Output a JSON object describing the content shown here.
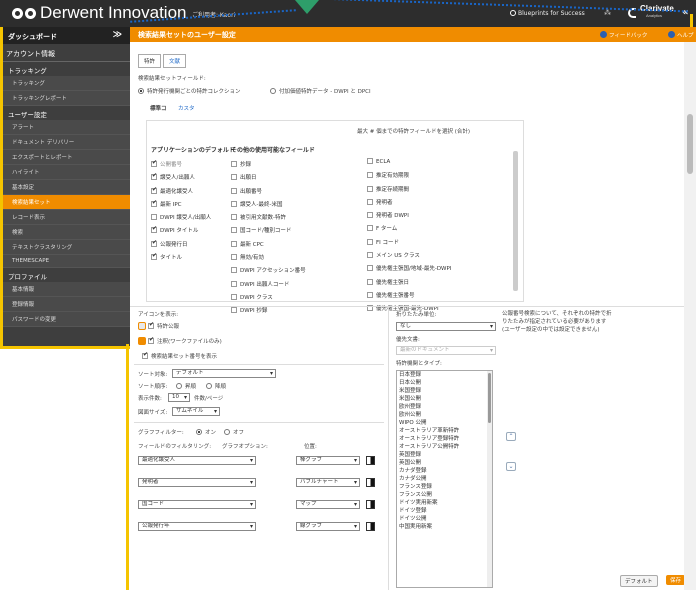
{
  "header": {
    "brand": "Derwent Innovation",
    "user": "ご利用者: Kaori",
    "blueprints": "Blueprints for Success",
    "lang_icon": "globe-language-icon",
    "clarivate": "Clarivate",
    "clarivate_sub": "Analytics",
    "collapse": "«"
  },
  "sidebar": {
    "head": "ダッシュボード",
    "account": "アカウント情報",
    "groups": [
      {
        "label": "トラッキング",
        "items": [
          "トラッキング",
          "トラッキングレポート"
        ]
      },
      {
        "label": "ユーザー設定",
        "items": [
          "アラート",
          "ドキュメント デリバリー",
          "エクスポートとレポート",
          "ハイライト",
          "基本設定",
          "検索結果セット",
          "レコード表示",
          "検索",
          "テキストクラスタリング",
          "THEMESCAPE"
        ]
      },
      {
        "label": "プロファイル",
        "items": [
          "基本情報",
          "登録情報",
          "パスワードの変更"
        ]
      }
    ],
    "active": "検索結果セット"
  },
  "titlebar": {
    "title": "検索結果セットのユーザー設定",
    "feedback": "フィードバック",
    "help": "ヘルプ"
  },
  "tabs": [
    "特許",
    "文献"
  ],
  "fields_section": {
    "label": "検索結果セットフィールド:",
    "radio1": "特許発行機関ごとの特許コレクション",
    "radio2": "付加価値特許データ - DWPI と DPCI",
    "sub_tab1": "標準コ",
    "sub_tab2": "カスタ",
    "max_note": "最大 # 個までの特許フィールドを選択 (合計)",
    "default_header": "アプリケーションのデフォルト",
    "other_header": "その他の使用可能なフィールド",
    "defaults": [
      {
        "label": "公開番号",
        "checked": true,
        "grey": true
      },
      {
        "label": "譲受人/出願人",
        "checked": true,
        "grey": false
      },
      {
        "label": "最適化譲受人",
        "checked": true,
        "grey": false
      },
      {
        "label": "最新 IPC",
        "checked": true,
        "grey": false
      },
      {
        "label": "DWPI 譲受人/出願人",
        "checked": false,
        "grey": false
      },
      {
        "label": "DWPI タイトル",
        "checked": true,
        "grey": false
      },
      {
        "label": "公報発行日",
        "checked": true,
        "grey": false
      },
      {
        "label": "タイトル",
        "checked": true,
        "grey": false
      }
    ],
    "others_a": [
      "抄録",
      "出願日",
      "出願番号",
      "譲受人-最終-米国",
      "被引用文献数-特許",
      "国コード/種別コード",
      "最新 CPC",
      "無効/有効",
      "DWPI アクセッション番号",
      "DWPI 出願人コード",
      "DWPI クラス",
      "DWPI 抄録"
    ],
    "others_b": [
      "ECLA",
      "推定有効期限",
      "推定存続期間",
      "発明者",
      "発明者 DWPI",
      "F ターム",
      "FI コード",
      "メイン US クラス",
      "優先権主張国/地域-最先-DWPI",
      "優先権主張日",
      "優先権主張番号",
      "優先権主張国-最先-DWPI"
    ]
  },
  "options": {
    "icons_label": "アイコンを表示:",
    "icon1": "特許公報",
    "icon2": "注釈(ワークファイルのみ)",
    "show_number": "検索結果セット番号を表示",
    "sort_label": "ソート対象:",
    "sort_value": "デフォルト",
    "order_label": "ソート順序:",
    "order_asc": "昇順",
    "order_desc": "降順",
    "per_page_label": "表示件数:",
    "per_page_value": "10",
    "per_page_unit": "件数/ページ",
    "image_label": "図面サイズ:",
    "image_value": "サムネイル",
    "graph_label": "グラフフィルター:",
    "graph_on": "オン",
    "graph_off": "オフ",
    "field_filter_label": "フィールドのフィルタリング:",
    "graph_option_label": "グラフオプション:",
    "position_label": "位置:",
    "filters": [
      {
        "field": "最適化譲受人",
        "graph": "棒グラフ"
      },
      {
        "field": "発明者",
        "graph": "バブルチャート"
      },
      {
        "field": "国コード",
        "graph": "マップ"
      },
      {
        "field": "公報発行年",
        "graph": "線グラフ"
      }
    ]
  },
  "fold": {
    "label": "折りたたみ単位:",
    "value": "なし",
    "note": "公報番号検索について、それぞれの特許で折りたたみが指定されている必要があります (ユーザー設定の中では設定できません)",
    "priority_label": "優先文書:",
    "priority_value": "最新のドキュメント",
    "list_label": "特許機関とタイプ:",
    "list": [
      "日本登録",
      "日本公開",
      "米国登録",
      "米国公開",
      "欧州登録",
      "欧州公開",
      "WIPO 公開",
      "オーストラリア革新特許",
      "オーストラリア登録特許",
      "オーストラリア公開特許",
      "英国登録",
      "英国公開",
      "カナダ登録",
      "カナダ公開",
      "フランス登録",
      "フランス公開",
      "ドイツ実用新案",
      "ドイツ登録",
      "ドイツ公開",
      "中国実用新案"
    ]
  },
  "buttons": {
    "default": "デフォルト",
    "save": "保存"
  },
  "colors": {
    "accent": "#f08c00",
    "highlight": "#f5c400",
    "header_bg": "#2d2d2d",
    "sidebar_bg": "#3e3e3e",
    "link": "#1a66c7",
    "marker": "#2e9e6a"
  }
}
